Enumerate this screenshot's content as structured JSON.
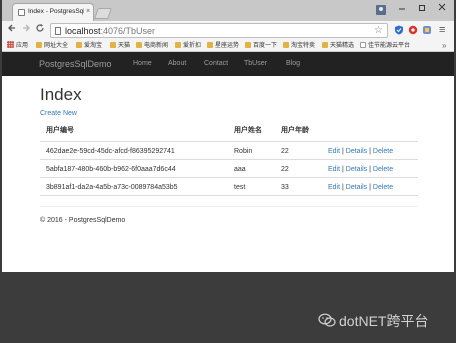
{
  "browser": {
    "tab_title": "Index - PostgresSqlDem",
    "tab_close": "×",
    "url_host": "localhost",
    "url_path": ":4076/TbUser",
    "bookmarks": [
      {
        "label": "应用",
        "icon": "apps-icon"
      },
      {
        "label": "网址大全",
        "icon": "folder-icon"
      },
      {
        "label": "爱淘宝",
        "icon": "folder-icon"
      },
      {
        "label": "天猫",
        "icon": "folder-icon"
      },
      {
        "label": "电商新闻",
        "icon": "folder-icon"
      },
      {
        "label": "爱折扣",
        "icon": "folder-icon"
      },
      {
        "label": "星座运势",
        "icon": "folder-icon"
      },
      {
        "label": "百度一下",
        "icon": "folder-icon"
      },
      {
        "label": "淘宝特卖",
        "icon": "folder-icon"
      },
      {
        "label": "天猫精选",
        "icon": "folder-icon"
      },
      {
        "label": "佳节能源云平台",
        "icon": "page-icon"
      }
    ],
    "bookmarks_more": "»",
    "colors": {
      "chrome_bg": "#f4f4f4",
      "tabstrip_bg": "#c8c8c8"
    }
  },
  "site": {
    "brand": "PostgresSqlDemo",
    "nav": [
      "Home",
      "About",
      "Contact",
      "TbUser",
      "Blog"
    ],
    "heading": "Index",
    "create_link": "Create New",
    "table": {
      "headers": [
        "用户编号",
        "用户姓名",
        "用户年龄"
      ],
      "rows": [
        {
          "id": "462dae2e-59cd-45dc-afcd-f86395292741",
          "name": "Robin",
          "age": "22"
        },
        {
          "id": "5abfa187-480b-460b-b962-6f0aaa7d6c44",
          "name": "aaa",
          "age": "22"
        },
        {
          "id": "3b891af1-da2a-4a5b-a73c-0089784a53b5",
          "name": "test",
          "age": "33"
        }
      ],
      "actions": {
        "edit": "Edit",
        "details": "Details",
        "delete": "Delete",
        "separator": " | "
      }
    },
    "footer": "© 2016 - PostgresSqlDemo",
    "colors": {
      "navbar_bg": "#222222",
      "link": "#337ab7",
      "nav_text": "#9d9d9d"
    }
  },
  "watermark": {
    "text": "dotNET跨平台",
    "color": "#d2d2d2"
  }
}
